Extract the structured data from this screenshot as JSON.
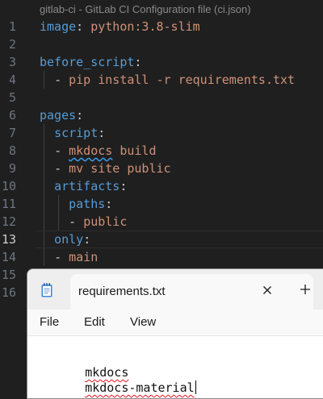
{
  "editor": {
    "schema_hint": "gitlab-ci - GitLab CI Configuration file (ci.json)",
    "lines": [
      {
        "number": "1",
        "indent": "",
        "key": "image",
        "punct": ": ",
        "value": "python:3.8-slim"
      },
      {
        "number": "2",
        "indent": "",
        "key": "",
        "punct": "",
        "value": ""
      },
      {
        "number": "3",
        "indent": "",
        "key": "before_script",
        "punct": ":",
        "value": ""
      },
      {
        "number": "4",
        "indent": "  ",
        "key": "",
        "punct": "- ",
        "value": "pip install -r requirements.txt"
      },
      {
        "number": "5",
        "indent": "",
        "key": "",
        "punct": "",
        "value": ""
      },
      {
        "number": "6",
        "indent": "",
        "key": "pages",
        "punct": ":",
        "value": ""
      },
      {
        "number": "7",
        "indent": "  ",
        "key": "script",
        "punct": ":",
        "value": ""
      },
      {
        "number": "8",
        "indent": "  ",
        "key": "",
        "punct": "- ",
        "value": "mkdocs build"
      },
      {
        "number": "9",
        "indent": "  ",
        "key": "",
        "punct": "- ",
        "value": "mv site public"
      },
      {
        "number": "10",
        "indent": "  ",
        "key": "artifacts",
        "punct": ":",
        "value": ""
      },
      {
        "number": "11",
        "indent": "    ",
        "key": "paths",
        "punct": ":",
        "value": ""
      },
      {
        "number": "12",
        "indent": "    ",
        "key": "",
        "punct": "- ",
        "value": "public"
      },
      {
        "number": "13",
        "indent": "  ",
        "key": "only",
        "punct": ":",
        "value": ""
      },
      {
        "number": "14",
        "indent": "  ",
        "key": "",
        "punct": "- ",
        "value": "main"
      },
      {
        "number": "15",
        "indent": "",
        "key": "",
        "punct": "",
        "value": ""
      },
      {
        "number": "16",
        "indent": "",
        "key": "",
        "punct": "",
        "value": ""
      }
    ],
    "active_line": "13"
  },
  "notepad": {
    "tab_title": "requirements.txt",
    "close_symbol": "✕",
    "new_tab_symbol": "+",
    "menu": [
      "File",
      "Edit",
      "View"
    ],
    "content_lines": [
      "mkdocs",
      "mkdocs-material"
    ]
  },
  "colors": {
    "editor_bg": "#1f1f1f",
    "yaml_key": "#569cd6",
    "yaml_string": "#ce9178",
    "line_number": "#6e7681",
    "spell_error": "#e81123"
  },
  "icons": {
    "notepad_app": "notepad-icon",
    "tab_close": "close-icon",
    "new_tab": "plus-icon"
  }
}
